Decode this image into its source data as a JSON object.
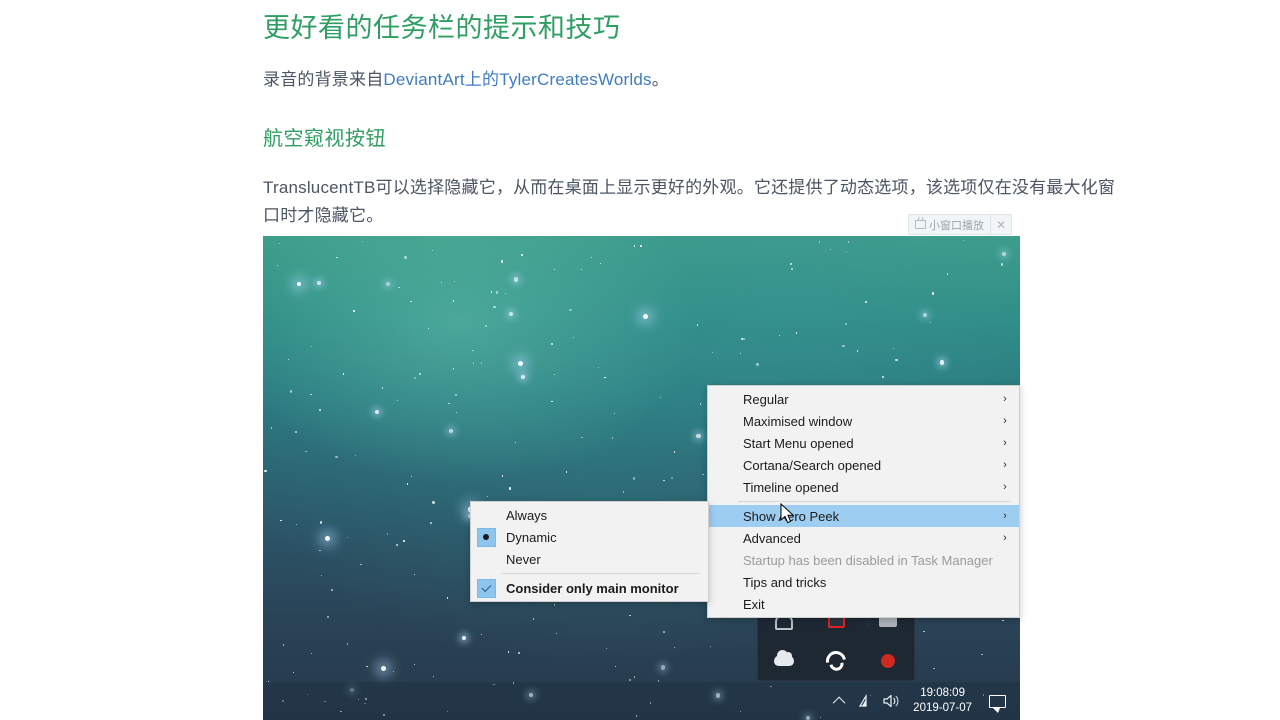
{
  "article": {
    "h1": "更好看的任务栏的提示和技巧",
    "intro_prefix": "录音的背景来自",
    "intro_link1": "DeviantArt",
    "intro_mid": "上的",
    "intro_link2": "TylerCreatesWorlds",
    "intro_suffix": "。",
    "h2": "航空窥视按钮",
    "body": "TranslucentTB可以选择隐藏它，从而在桌面上显示更好的外观。它还提供了动态选项，该选项仅在没有最大化窗口时才隐藏它。"
  },
  "player_pill": {
    "label": "小窗口播放",
    "close_label": "✕"
  },
  "context_menu": {
    "items": [
      {
        "label": "Regular",
        "arrow": "›",
        "state": "normal"
      },
      {
        "label": "Maximised window",
        "arrow": "›",
        "state": "normal"
      },
      {
        "label": "Start Menu opened",
        "arrow": "›",
        "state": "normal"
      },
      {
        "label": "Cortana/Search opened",
        "arrow": "›",
        "state": "normal"
      },
      {
        "label": "Timeline opened",
        "arrow": "›",
        "state": "normal"
      },
      {
        "label": "Show Aero Peek",
        "arrow": "›",
        "state": "selected"
      },
      {
        "label": "Advanced",
        "arrow": "›",
        "state": "normal"
      },
      {
        "label": "Startup has been disabled in Task Manager",
        "arrow": "",
        "state": "disabled"
      },
      {
        "label": "Tips and tricks",
        "arrow": "",
        "state": "normal"
      },
      {
        "label": "Exit",
        "arrow": "",
        "state": "normal"
      }
    ]
  },
  "sub_menu": {
    "items": [
      {
        "label": "Always",
        "marker": "none",
        "bold": false
      },
      {
        "label": "Dynamic",
        "marker": "radio",
        "bold": false
      },
      {
        "label": "Never",
        "marker": "none",
        "bold": false
      },
      {
        "label": "Consider only main monitor",
        "marker": "check",
        "bold": true
      }
    ]
  },
  "taskbar": {
    "time": "19:08:09",
    "date": "2019-07-07"
  },
  "colors": {
    "heading_green": "#2f9e63",
    "link_blue": "#3e7cc4",
    "menu_bg": "#f2f2f2",
    "menu_highlight": "#9ecdf2",
    "checkbox_blue": "#8ec5ef"
  }
}
